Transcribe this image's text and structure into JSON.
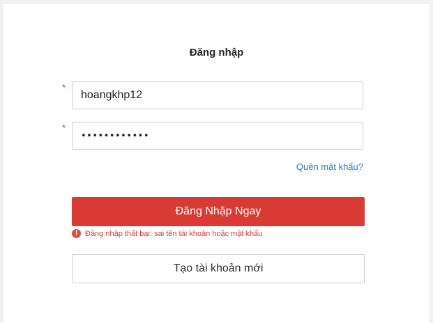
{
  "form": {
    "title": "Đăng nhập",
    "required_mark": "*",
    "username": {
      "value": "hoangkhp12",
      "placeholder": ""
    },
    "password": {
      "value": "hoangkhp1234",
      "placeholder": ""
    },
    "forgot_password_label": "Quên mật khẩu?",
    "login_button_label": "Đăng Nhập Ngay",
    "error": {
      "icon": "!",
      "message": "Đăng nhập thất bại: sai tên tài khoản hoặc mật khẩu"
    },
    "register_button_label": "Tạo tài khoản mới"
  },
  "colors": {
    "primary": "#d93a33",
    "error": "#d93838",
    "link": "#2a79c9"
  }
}
